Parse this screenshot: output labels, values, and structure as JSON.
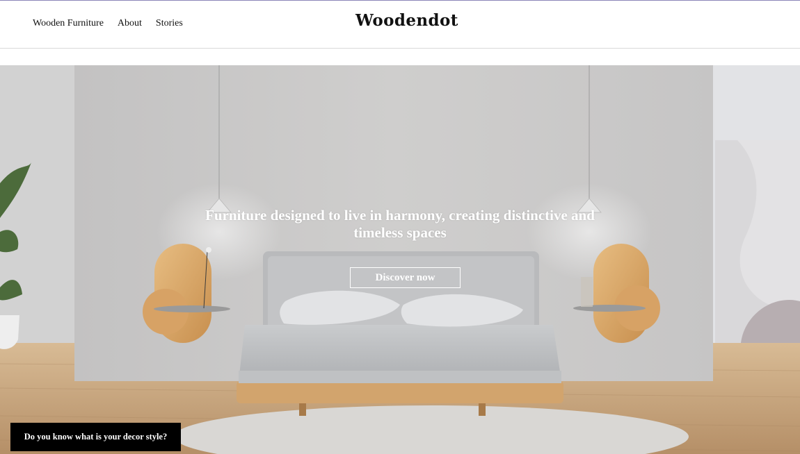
{
  "nav": {
    "items": [
      {
        "label": "Wooden Furniture"
      },
      {
        "label": "About"
      },
      {
        "label": "Stories"
      }
    ]
  },
  "brand": {
    "logo_text": "Woodendot"
  },
  "hero": {
    "title": "Furniture designed to live in harmony, creating distinctive and timeless spaces",
    "cta_label": "Discover now"
  },
  "floating_cta": {
    "label": "Do you know what is your decor style?"
  },
  "colors": {
    "accent_rule": "#8b84b8",
    "wall": "#c7c6c6",
    "wood": "#d9a867",
    "floor": "#c9a67f",
    "button_bg": "#000000"
  }
}
